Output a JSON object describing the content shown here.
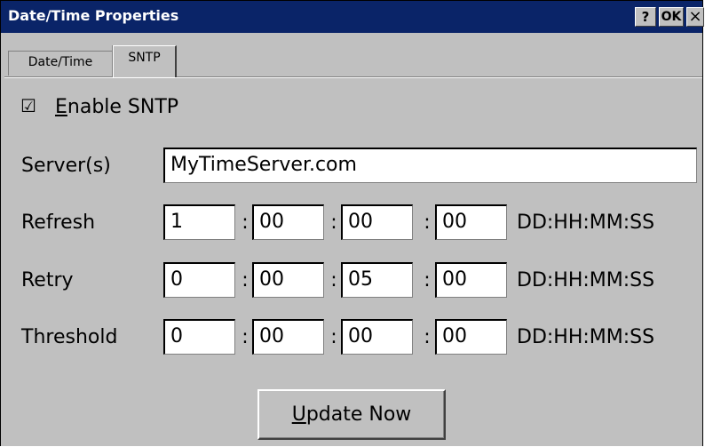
{
  "window": {
    "title": "Date/Time Properties",
    "help_label": "?",
    "ok_label": "OK",
    "close_label": "×"
  },
  "tabs": [
    {
      "label": "Date/Time",
      "active": false
    },
    {
      "label": "SNTP",
      "active": true
    }
  ],
  "enable_sntp": {
    "checked": true,
    "check_glyph": "☑",
    "label": "Enable SNTP"
  },
  "server": {
    "label": "Server(s)",
    "value": "MyTimeServer.com"
  },
  "separator": ":",
  "rows": [
    {
      "label": "Refresh",
      "values": [
        "1",
        "00",
        "00",
        "00"
      ],
      "unit": "DD:HH:MM:SS"
    },
    {
      "label": "Retry",
      "values": [
        "0",
        "00",
        "05",
        "00"
      ],
      "unit": "DD:HH:MM:SS"
    },
    {
      "label": "Threshold",
      "values": [
        "0",
        "00",
        "00",
        "00"
      ],
      "unit": "DD:HH:MM:SS"
    }
  ],
  "update_button": {
    "label": "Update Now"
  },
  "colors": {
    "titlebar": "#0a2468",
    "dialog_bg": "#c0c0c0"
  }
}
